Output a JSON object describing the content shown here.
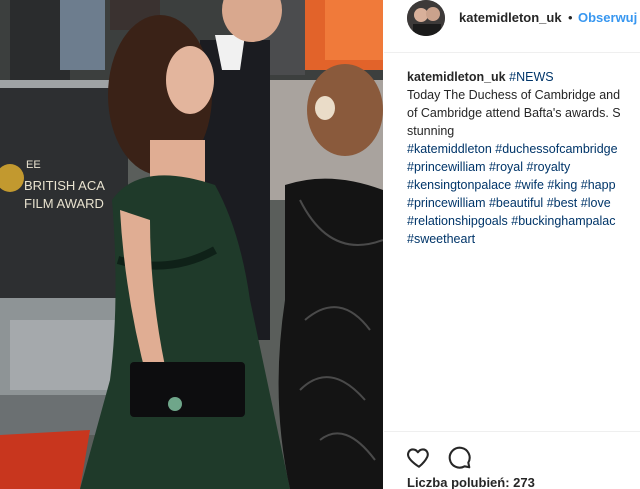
{
  "post": {
    "username": "katemidleton_uk",
    "separator": "•",
    "follow_label": "Obserwuj"
  },
  "caption": {
    "username": "katemidleton_uk",
    "first_tag": "#NEWS",
    "text_lines": [
      "Today The Duchess of Cambridge and",
      "of Cambridge attend Bafta's awards. S",
      "stunning"
    ],
    "hashtag_lines": [
      [
        "#katemiddleton",
        "#duchessofcambridge"
      ],
      [
        "#princewilliam",
        "#royal",
        "#royalty"
      ],
      [
        "#kensingtonpalace",
        "#wife",
        "#king",
        "#happ"
      ],
      [
        "#princewilliam",
        "#beautiful",
        "#best",
        "#love"
      ],
      [
        "#relationshipgoals",
        "#buckinghampalac"
      ],
      [
        "#sweetheart"
      ]
    ]
  },
  "photo": {
    "banner_line1": "EE",
    "banner_line2": "BRITISH ACA",
    "banner_line3": "FILM AWARD"
  },
  "actions": {
    "like_icon": "heart-outline-icon",
    "comment_icon": "speech-bubble-icon"
  },
  "likes": {
    "label": "Liczba polubień: 273"
  },
  "colors": {
    "follow": "#3897f0",
    "hashtag": "#003569",
    "dress": "#1f3a2a",
    "carpet": "#c8361e"
  }
}
